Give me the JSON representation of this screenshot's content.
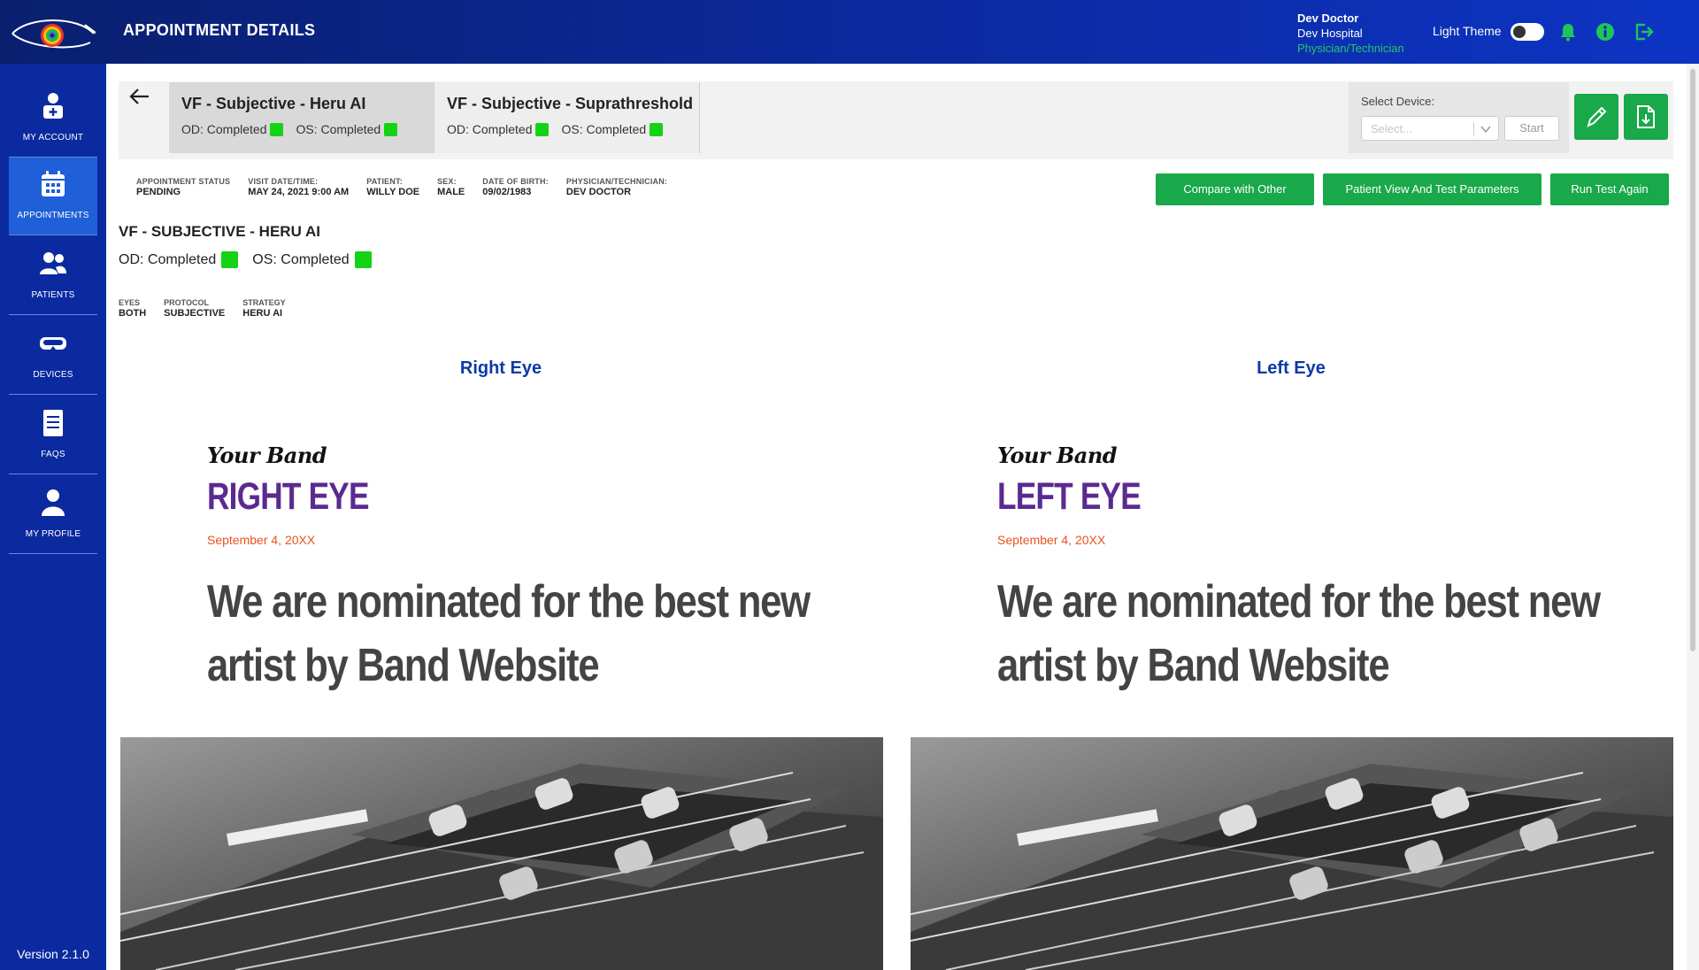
{
  "header": {
    "title": "APPOINTMENT DETAILS",
    "user_name": "Dev Doctor",
    "hospital": "Dev Hospital",
    "role": "Physician/Technician",
    "theme_label": "Light Theme"
  },
  "sidebar": {
    "items": [
      {
        "label": "MY ACCOUNT",
        "icon": "account-icon"
      },
      {
        "label": "APPOINTMENTS",
        "icon": "calendar-icon"
      },
      {
        "label": "PATIENTS",
        "icon": "patients-icon"
      },
      {
        "label": "DEVICES",
        "icon": "vr-headset-icon"
      },
      {
        "label": "FAQS",
        "icon": "document-icon"
      },
      {
        "label": "MY PROFILE",
        "icon": "profile-icon"
      }
    ],
    "version": "Version 2.1.0"
  },
  "tabs": [
    {
      "title": "VF - Subjective - Heru AI",
      "od": "OD: Completed",
      "os": "OS: Completed"
    },
    {
      "title": "VF - Subjective - Suprathreshold",
      "od": "OD: Completed",
      "os": "OS: Completed"
    }
  ],
  "device": {
    "label": "Select Device:",
    "placeholder": "Select...",
    "start_label": "Start"
  },
  "appointment": {
    "status_label": "APPOINTMENT STATUS",
    "status": "PENDING",
    "visit_label": "VISIT DATE/TIME:",
    "visit": "MAY 24, 2021 9:00 AM",
    "patient_label": "PATIENT:",
    "patient": "WILLY DOE",
    "sex_label": "SEX:",
    "sex": "MALE",
    "dob_label": "DATE OF BIRTH:",
    "dob": "09/02/1983",
    "physician_label": "PHYSICIAN/TECHNICIAN:",
    "physician": "DEV DOCTOR"
  },
  "actions": {
    "compare": "Compare with Other",
    "patient_view": "Patient View And Test Parameters",
    "run_again": "Run Test Again"
  },
  "test": {
    "title": "VF - SUBJECTIVE - HERU AI",
    "od": "OD: Completed",
    "os": "OS: Completed",
    "eyes_label": "EYES",
    "eyes": "BOTH",
    "protocol_label": "PROTOCOL",
    "protocol": "SUBJECTIVE",
    "strategy_label": "STRATEGY",
    "strategy": "HERU AI"
  },
  "right_eye": {
    "heading": "Right Eye",
    "brand": "Your Band",
    "big_title": "RIGHT EYE",
    "date": "September 4, 20XX",
    "headline_1": "We are nominated for the best new",
    "headline_2": "artist by Band Website"
  },
  "left_eye": {
    "heading": "Left Eye",
    "brand": "Your Band",
    "big_title": "LEFT EYE",
    "date": "September 4, 20XX",
    "headline_1": "We are nominated for the best new",
    "headline_2": "artist by Band Website"
  },
  "colors": {
    "header_blue": "#0b2aa0",
    "active_nav": "#1f5fd8",
    "action_green": "#19a84a",
    "status_green": "#14d214",
    "heading_blue": "#0b3aa8",
    "eye_purple": "#5b2a91",
    "date_orange": "#e8531f"
  }
}
